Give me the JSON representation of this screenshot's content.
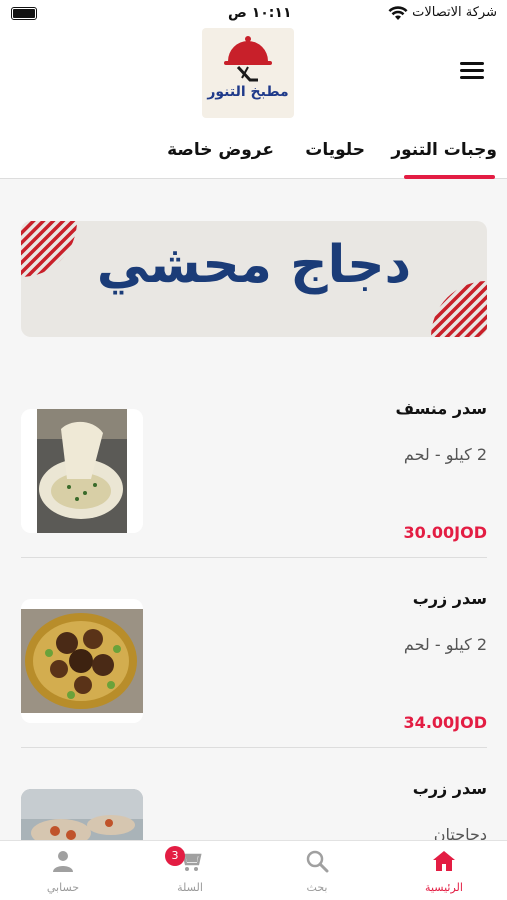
{
  "status_bar": {
    "carrier": "شركة الاتصالات",
    "time": "١٠:١١ ص"
  },
  "header": {
    "logo_text": "مطبخ التنور"
  },
  "tabs": [
    {
      "label": "وجبات التنور",
      "active": true
    },
    {
      "label": "حلويات",
      "active": false
    },
    {
      "label": "عروض خاصة",
      "active": false
    }
  ],
  "banner": {
    "text": "دجاج محشي"
  },
  "products": [
    {
      "title": "سدر منسف",
      "desc": "2 كيلو - لحم",
      "price": "30.00JOD",
      "image": "mansaf-photo"
    },
    {
      "title": "سدر زرب",
      "desc": "2 كيلو - لحم",
      "price": "34.00JOD",
      "image": "zarb-meat-photo"
    },
    {
      "title": "سدر زرب",
      "desc": "دجاجتان",
      "price": "",
      "image": "zarb-chicken-photo"
    }
  ],
  "bottom_nav": {
    "home": "الرئيسية",
    "search": "بحث",
    "cart": "السلة",
    "cart_count": "3",
    "account": "حسابي"
  },
  "colors": {
    "accent": "#e31d43",
    "banner_text": "#1b3c78",
    "logo_text": "#1f3a8a"
  }
}
